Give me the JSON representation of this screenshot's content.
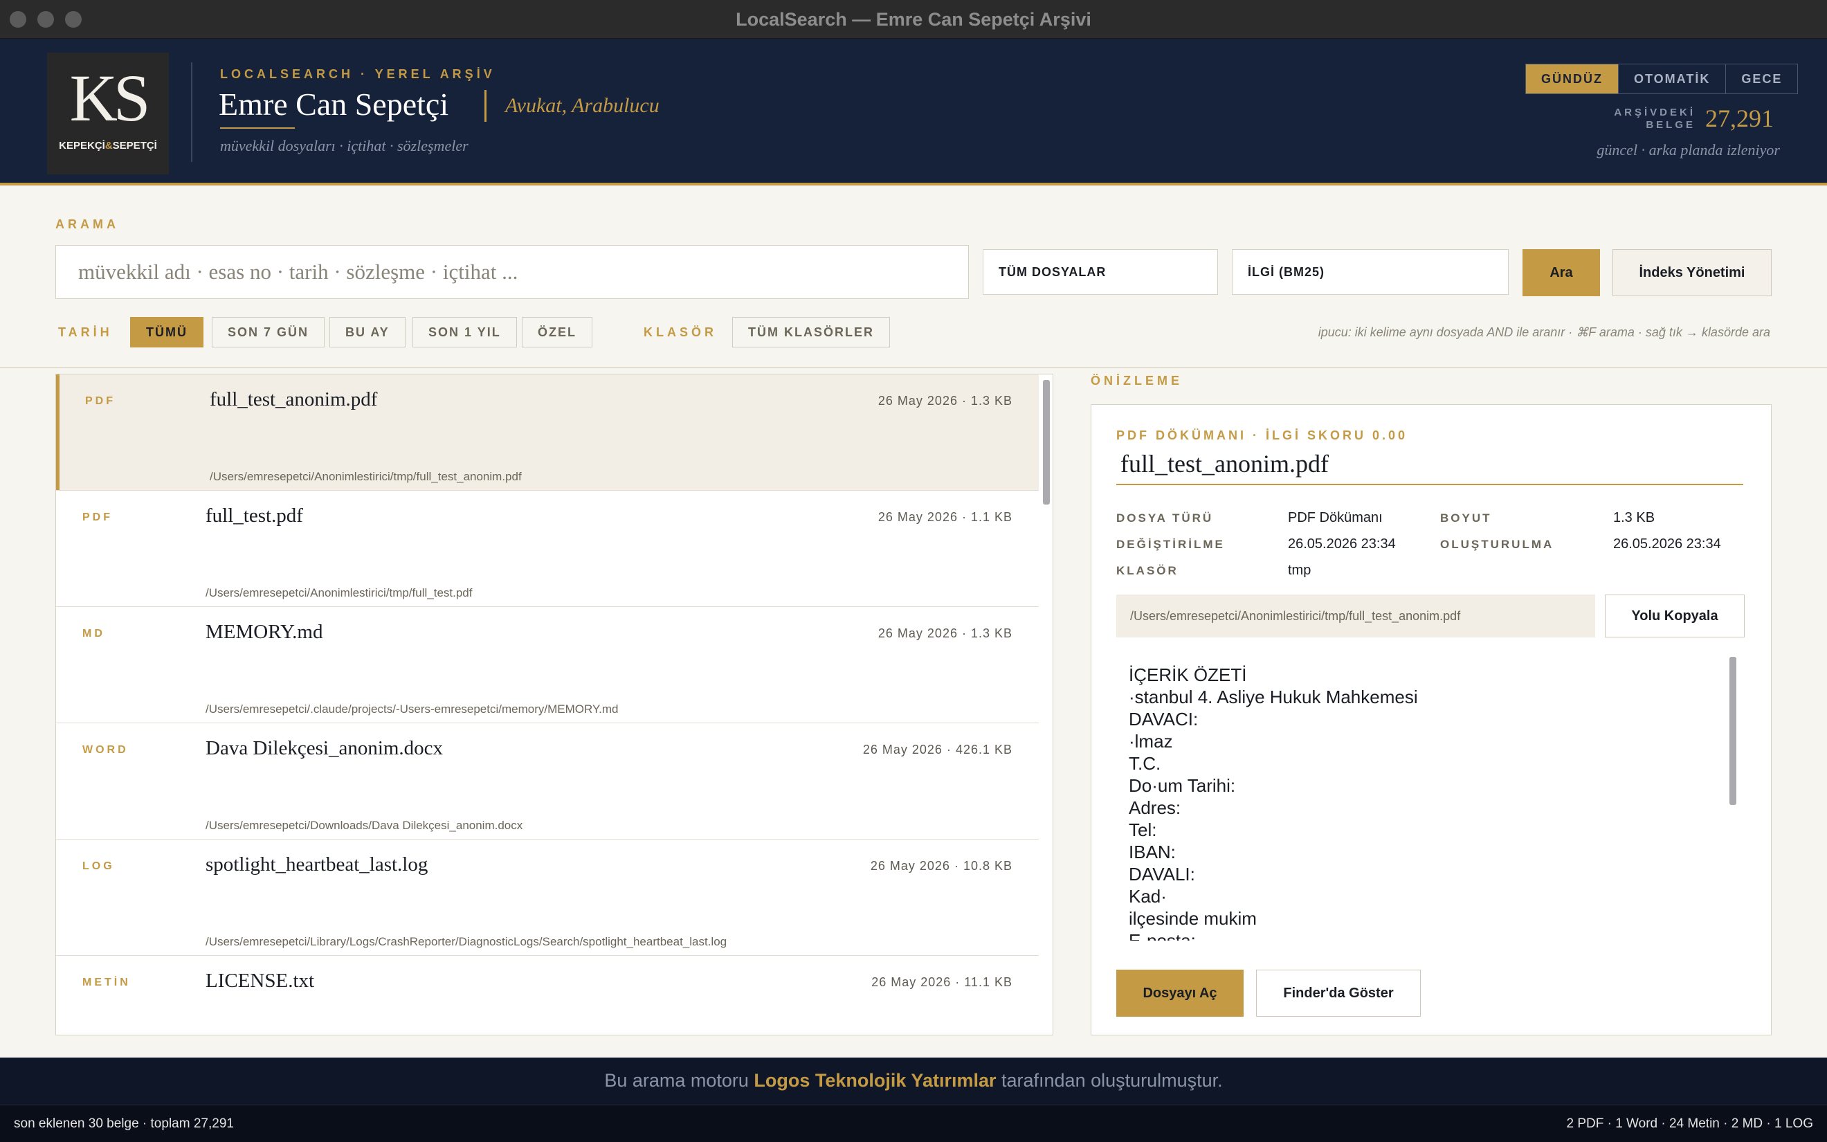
{
  "window": {
    "title": "LocalSearch — Emre Can Sepetçi Arşivi"
  },
  "header": {
    "logo_mono": "KS",
    "logo_firm_left": "KEPEKÇİ",
    "logo_firm_amp": "&",
    "logo_firm_right": "SEPETÇİ",
    "kicker": "LOCALSEARCH  ·  YEREL ARŞİV",
    "name": "Emre Can Sepetçi",
    "role": "Avukat,  Arabulucu",
    "subtitle": "müvekkil dosyaları  ·  içtihat  ·  sözleşmeler",
    "theme_options": [
      "GÜNDÜZ",
      "OTOMATİK",
      "GECE"
    ],
    "theme_active": "GÜNDÜZ",
    "count_label_1": "ARŞİVDEKİ",
    "count_label_2": "BELGE",
    "count_value": "27,291",
    "live_status": "güncel · arka planda izleniyor"
  },
  "search": {
    "section_label": "ARAMA",
    "placeholder": "müvekkil adı · esas no · tarih · sözleşme · içtihat ...",
    "value": "",
    "scope_select": "TÜM DOSYALAR",
    "sort_select": "İLGİ (BM25)",
    "search_button": "Ara",
    "index_button": "İndeks Yönetimi"
  },
  "filters": {
    "date_label": "TARİH",
    "date_chips": [
      "TÜMÜ",
      "SON 7 GÜN",
      "BU AY",
      "SON 1 YIL",
      "ÖZEL"
    ],
    "date_active": "TÜMÜ",
    "folder_label": "KLASÖR",
    "folder_chip": "TÜM KLASÖRLER",
    "hint": "ipucu:  iki kelime aynı dosyada AND ile aranır  ·  ⌘F arama  ·  sağ tık → klasörde ara"
  },
  "results": [
    {
      "type": "PDF",
      "name": "full_test_anonim.pdf",
      "meta": "26 May 2026  ·  1.3 KB",
      "path": "/Users/emresepetci/Anonimlestirici/tmp/full_test_anonim.pdf"
    },
    {
      "type": "PDF",
      "name": "full_test.pdf",
      "meta": "26 May 2026  ·  1.1 KB",
      "path": "/Users/emresepetci/Anonimlestirici/tmp/full_test.pdf"
    },
    {
      "type": "MD",
      "name": "MEMORY.md",
      "meta": "26 May 2026  ·  1.3 KB",
      "path": "/Users/emresepetci/.claude/projects/-Users-emresepetci/memory/MEMORY.md"
    },
    {
      "type": "WORD",
      "name": "Dava Dilekçesi_anonim.docx",
      "meta": "26 May 2026  ·  426.1 KB",
      "path": "/Users/emresepetci/Downloads/Dava Dilekçesi_anonim.docx"
    },
    {
      "type": "LOG",
      "name": "spotlight_heartbeat_last.log",
      "meta": "26 May 2026  ·  10.8 KB",
      "path": "/Users/emresepetci/Library/Logs/CrashReporter/DiagnosticLogs/Search/spotlight_heartbeat_last.log"
    },
    {
      "type": "METİN",
      "name": "LICENSE.txt",
      "meta": "26 May 2026  ·  11.1 KB",
      "path": ""
    }
  ],
  "preview": {
    "section_label": "ÖNİZLEME",
    "kicker": "PDF DÖKÜMANI  ·  İLGİ SKORU 0.00",
    "title": "full_test_anonim.pdf",
    "file_type_label": "DOSYA TÜRÜ",
    "file_type": "PDF Dökümanı",
    "size_label": "BOYUT",
    "size": "1.3 KB",
    "modified_label": "DEĞİŞTİRİLME",
    "modified": "26.05.2026 23:34",
    "created_label": "OLUŞTURULMA",
    "created": "26.05.2026 23:34",
    "folder_label": "KLASÖR",
    "folder": "tmp",
    "path": "/Users/emresepetci/Anonimlestirici/tmp/full_test_anonim.pdf",
    "copy_button": "Yolu Kopyala",
    "content": "İÇERİK ÖZETİ\n·stanbul 4. Asliye Hukuk Mahkemesi\nDAVACI:\n·lmaz\nT.C.\nDo·um Tarihi:\nAdres:\nTel:\nIBAN:\nDAVALI:\nKad·\nilçesinde mukim\nE-posta:",
    "open_button": "Dosyayı Aç",
    "finder_button": "Finder'da Göster"
  },
  "footer": {
    "credit_prefix": "Bu arama motoru ",
    "credit_brand": "Logos Teknolojik Yatırımlar",
    "credit_suffix": " tarafından oluşturulmuştur.",
    "status_left": "son eklenen 30 belge  ·  toplam 27,291",
    "status_right": "2 PDF  ·  1 Word  ·  24 Metin  ·  2 MD  ·  1 LOG"
  }
}
